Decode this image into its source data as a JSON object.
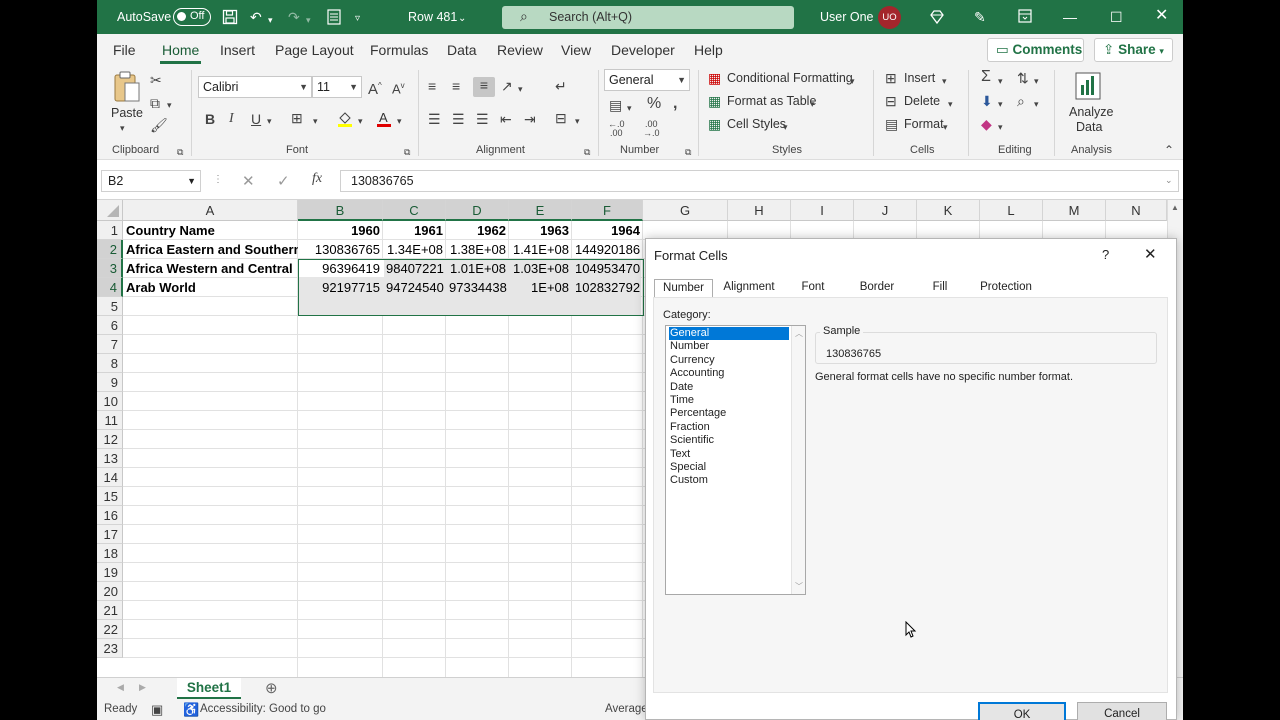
{
  "titlebar": {
    "autosave": "AutoSave",
    "toggle": "Off",
    "doc_title": "Row 481",
    "search_placeholder": "Search (Alt+Q)",
    "user": "User One",
    "initials": "UO"
  },
  "menu": {
    "items": [
      "File",
      "Home",
      "Insert",
      "Page Layout",
      "Formulas",
      "Data",
      "Review",
      "View",
      "Developer",
      "Help"
    ],
    "active": "Home",
    "comments": "Comments",
    "share": "Share"
  },
  "ribbon": {
    "paste": "Paste",
    "font_name": "Calibri",
    "font_size": "11",
    "number_format": "General",
    "conditional_formatting": "Conditional Formatting",
    "format_as_table": "Format as Table",
    "cell_styles": "Cell Styles",
    "insert": "Insert",
    "delete": "Delete",
    "format": "Format",
    "analyze": "Analyze",
    "analyze2": "Data",
    "groups": {
      "clipboard": "Clipboard",
      "font": "Font",
      "alignment": "Alignment",
      "number": "Number",
      "styles": "Styles",
      "cells": "Cells",
      "editing": "Editing",
      "analysis": "Analysis"
    }
  },
  "formula_bar": {
    "name_box": "B2",
    "value": "130836765"
  },
  "sheet": {
    "columns": [
      "A",
      "B",
      "C",
      "D",
      "E",
      "F",
      "G",
      "H",
      "I",
      "J",
      "K",
      "L",
      "M",
      "N"
    ],
    "rows": [
      "1",
      "2",
      "3",
      "4",
      "5",
      "6",
      "7",
      "8",
      "9",
      "10",
      "11",
      "12",
      "13",
      "14",
      "15",
      "16",
      "17",
      "18",
      "19",
      "20",
      "21",
      "22",
      "23"
    ],
    "header_row": [
      "Country Name",
      "1960",
      "1961",
      "1962",
      "1963",
      "1964"
    ],
    "data_rows": [
      [
        "Africa Eastern and Southern",
        "130836765",
        "1.34E+08",
        "1.38E+08",
        "1.41E+08",
        "144920186"
      ],
      [
        "Africa Western and Central",
        "96396419",
        "98407221",
        "1.01E+08",
        "1.03E+08",
        "104953470"
      ],
      [
        "Arab World",
        "92197715",
        "94724540",
        "97334438",
        "1E+08",
        "102832792"
      ]
    ],
    "tab": "Sheet1"
  },
  "status": {
    "ready": "Ready",
    "accessibility": "Accessibility: Good to go",
    "average": "Average"
  },
  "dialog": {
    "title": "Format Cells",
    "help": "?",
    "tabs": [
      "Number",
      "Alignment",
      "Font",
      "Border",
      "Fill",
      "Protection"
    ],
    "category_label": "Category:",
    "categories": [
      "General",
      "Number",
      "Currency",
      "Accounting",
      "Date",
      "Time",
      "Percentage",
      "Fraction",
      "Scientific",
      "Text",
      "Special",
      "Custom"
    ],
    "selected_category": "General",
    "sample_label": "Sample",
    "sample_value": "130836765",
    "description": "General format cells have no specific number format.",
    "ok": "OK",
    "cancel": "Cancel"
  }
}
